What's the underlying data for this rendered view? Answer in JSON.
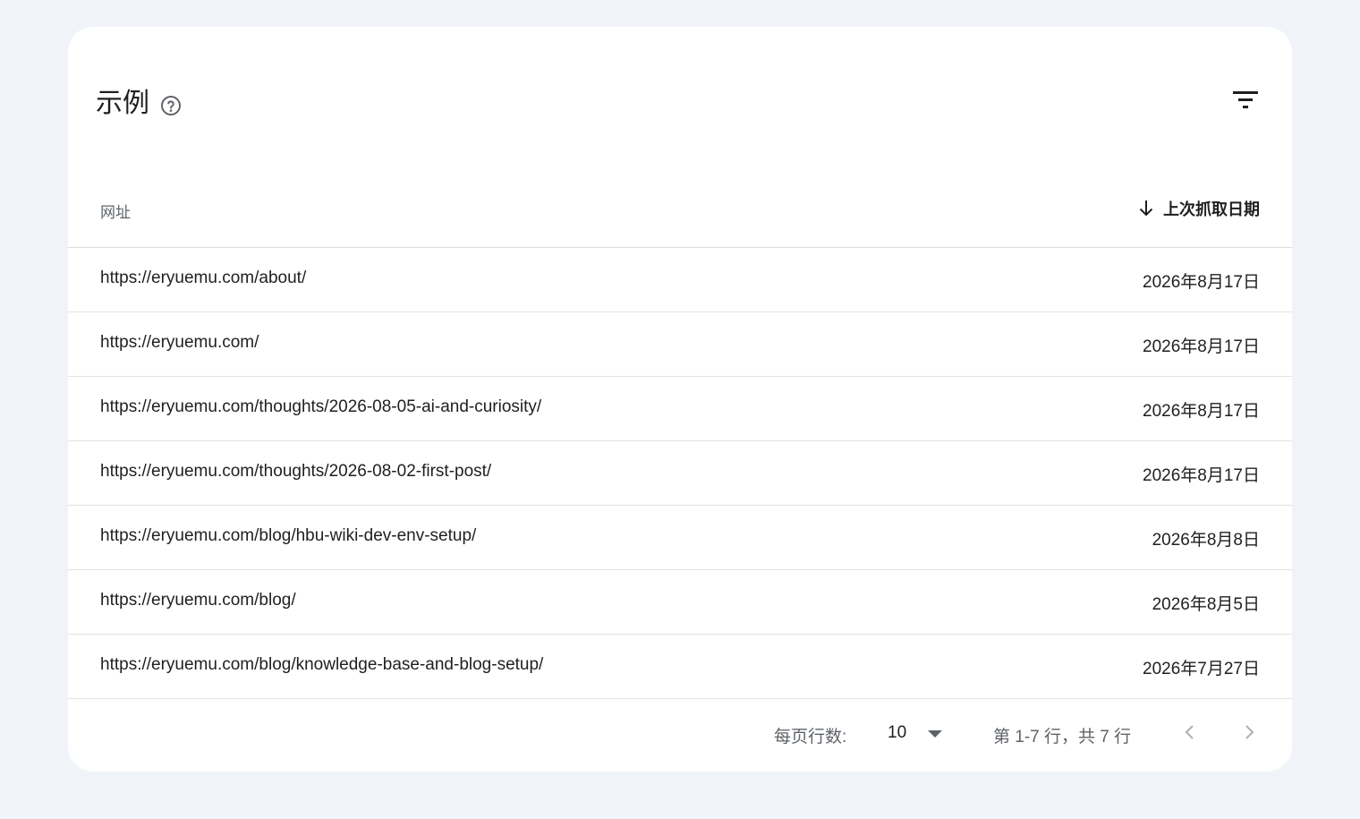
{
  "card": {
    "title": "示例",
    "help_icon": "help-circle-icon",
    "filter_icon": "filter-icon"
  },
  "table": {
    "columns": {
      "url": "网址",
      "date": "上次抓取日期",
      "date_sort_icon": "arrow-down-icon"
    },
    "rows": [
      {
        "url": "https://eryuemu.com/about/",
        "date": "2026年8月17日"
      },
      {
        "url": "https://eryuemu.com/",
        "date": "2026年8月17日"
      },
      {
        "url": "https://eryuemu.com/thoughts/2026-08-05-ai-and-curiosity/",
        "date": "2026年8月17日"
      },
      {
        "url": "https://eryuemu.com/thoughts/2026-08-02-first-post/",
        "date": "2026年8月17日"
      },
      {
        "url": "https://eryuemu.com/blog/hbu-wiki-dev-env-setup/",
        "date": "2026年8月8日"
      },
      {
        "url": "https://eryuemu.com/blog/",
        "date": "2026年8月5日"
      },
      {
        "url": "https://eryuemu.com/blog/knowledge-base-and-blog-setup/",
        "date": "2026年7月27日"
      }
    ]
  },
  "pagination": {
    "rows_per_page_label": "每页行数:",
    "rows_per_page_value": "10",
    "range_label": "第 1-7 行，共 7 行",
    "prev_icon": "chevron-left-icon",
    "next_icon": "chevron-right-icon"
  },
  "colors": {
    "background": "#f0f4f9",
    "card": "#ffffff",
    "text": "#1f1f1f",
    "muted_text": "#5f6368",
    "divider": "#e3e3e3",
    "disabled_icon": "#b0b3b8"
  }
}
